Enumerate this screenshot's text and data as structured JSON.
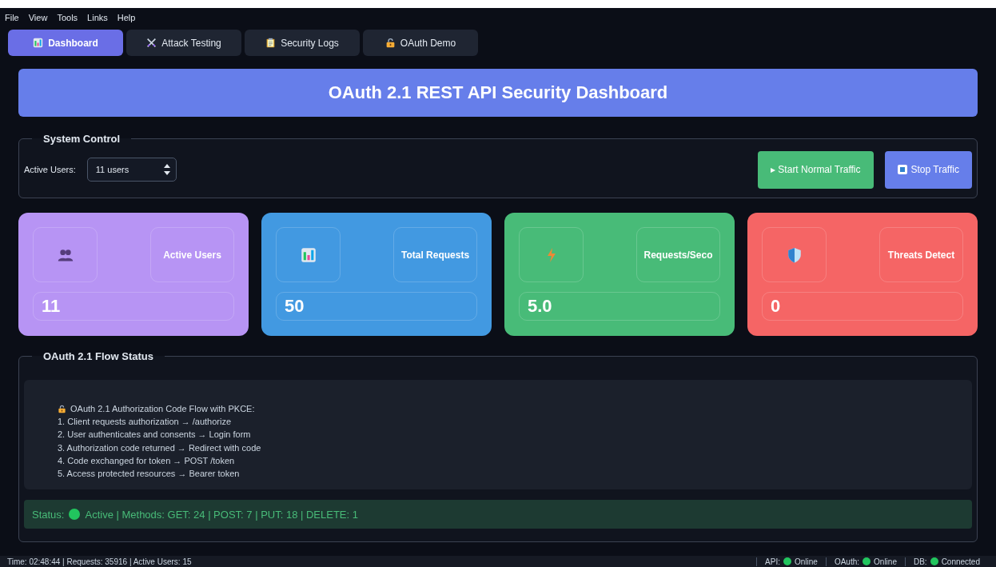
{
  "menu": [
    "File",
    "View",
    "Tools",
    "Links",
    "Help"
  ],
  "tabs": [
    {
      "label": "Dashboard",
      "kind": "chart",
      "selected": true
    },
    {
      "label": "Attack Testing",
      "kind": "swords",
      "selected": false
    },
    {
      "label": "Security Logs",
      "kind": "clipboard",
      "selected": false
    },
    {
      "label": "OAuth Demo",
      "kind": "lock",
      "selected": false
    }
  ],
  "header": {
    "title": "OAuth 2.1 REST API Security Dashboard"
  },
  "system_control": {
    "legend": "System Control",
    "active_users_label": "Active Users:",
    "active_users_value": "11 users",
    "buttons": [
      {
        "label": "▸ Start Normal Traffic",
        "kind": "start"
      },
      {
        "label": "Stop Traffic",
        "kind": "stop"
      }
    ]
  },
  "cards": [
    {
      "label": "Active Users",
      "value": "11",
      "kind": "users",
      "color": "#b794f4"
    },
    {
      "label": "Total Requests",
      "value": "50",
      "kind": "chart",
      "color": "#4299e1"
    },
    {
      "label": "Requests/Seco",
      "value": "5.0",
      "kind": "bolt",
      "color": "#48bb78"
    },
    {
      "label": "Threats Detect",
      "value": "0",
      "kind": "shield",
      "color": "#f56565"
    }
  ],
  "flow": {
    "legend": "OAuth 2.1 Flow Status",
    "heading": "OAuth 2.1 Authorization Code Flow with PKCE:",
    "steps": [
      "1. Client requests authorization → /authorize",
      "2. User authenticates and consents → Login form",
      "3. Authorization code returned → Redirect with code",
      "4. Code exchanged for token → POST /token",
      "5. Access protected resources → Bearer token"
    ],
    "status_label": "Status:",
    "active": true,
    "status_text": "Active | Methods: GET: 24 | POST: 7 | PUT: 18 | DELETE: 1"
  },
  "status_bar": {
    "info": "Time: 02:48:44 | Requests: 35916 | Active Users: 15",
    "services": [
      {
        "label": "API:",
        "value": "Online",
        "ok": true
      },
      {
        "label": "OAuth:",
        "value": "Online",
        "ok": true
      },
      {
        "label": "DB:",
        "value": "Connected",
        "ok": true
      }
    ]
  }
}
